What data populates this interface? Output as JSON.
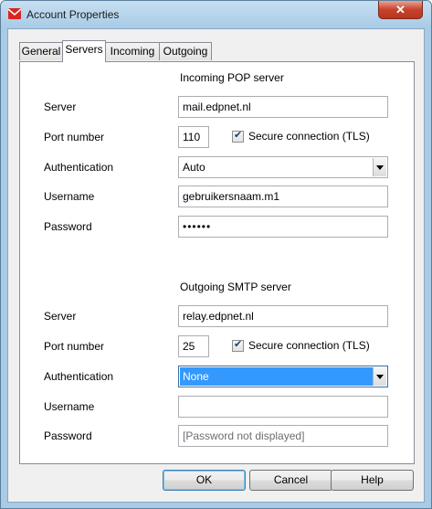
{
  "window": {
    "title": "Account Properties",
    "close_glyph": "✕"
  },
  "tabs": [
    {
      "label": "General",
      "active": false
    },
    {
      "label": "Servers",
      "active": true
    },
    {
      "label": "Incoming",
      "active": false
    },
    {
      "label": "Outgoing",
      "active": false
    }
  ],
  "incoming": {
    "title": "Incoming POP server",
    "server_label": "Server",
    "server_value": "mail.edpnet.nl",
    "port_label": "Port number",
    "port_value": "110",
    "secure_label": "Secure connection (TLS)",
    "secure_checked": true,
    "auth_label": "Authentication",
    "auth_value": "Auto",
    "username_label": "Username",
    "username_value": "gebruikersnaam.m1",
    "password_label": "Password",
    "password_value": "••••••"
  },
  "outgoing": {
    "title": "Outgoing SMTP server",
    "server_label": "Server",
    "server_value": "relay.edpnet.nl",
    "port_label": "Port number",
    "port_value": "25",
    "secure_label": "Secure connection (TLS)",
    "secure_checked": true,
    "auth_label": "Authentication",
    "auth_value": "None",
    "username_label": "Username",
    "username_value": "",
    "password_label": "Password",
    "password_placeholder": "[Password not displayed]"
  },
  "buttons": {
    "ok": "OK",
    "cancel": "Cancel",
    "help": "Help"
  },
  "colors": {
    "selection": "#3399ff",
    "frame": "#a9cbe6",
    "close": "#c7422b"
  }
}
